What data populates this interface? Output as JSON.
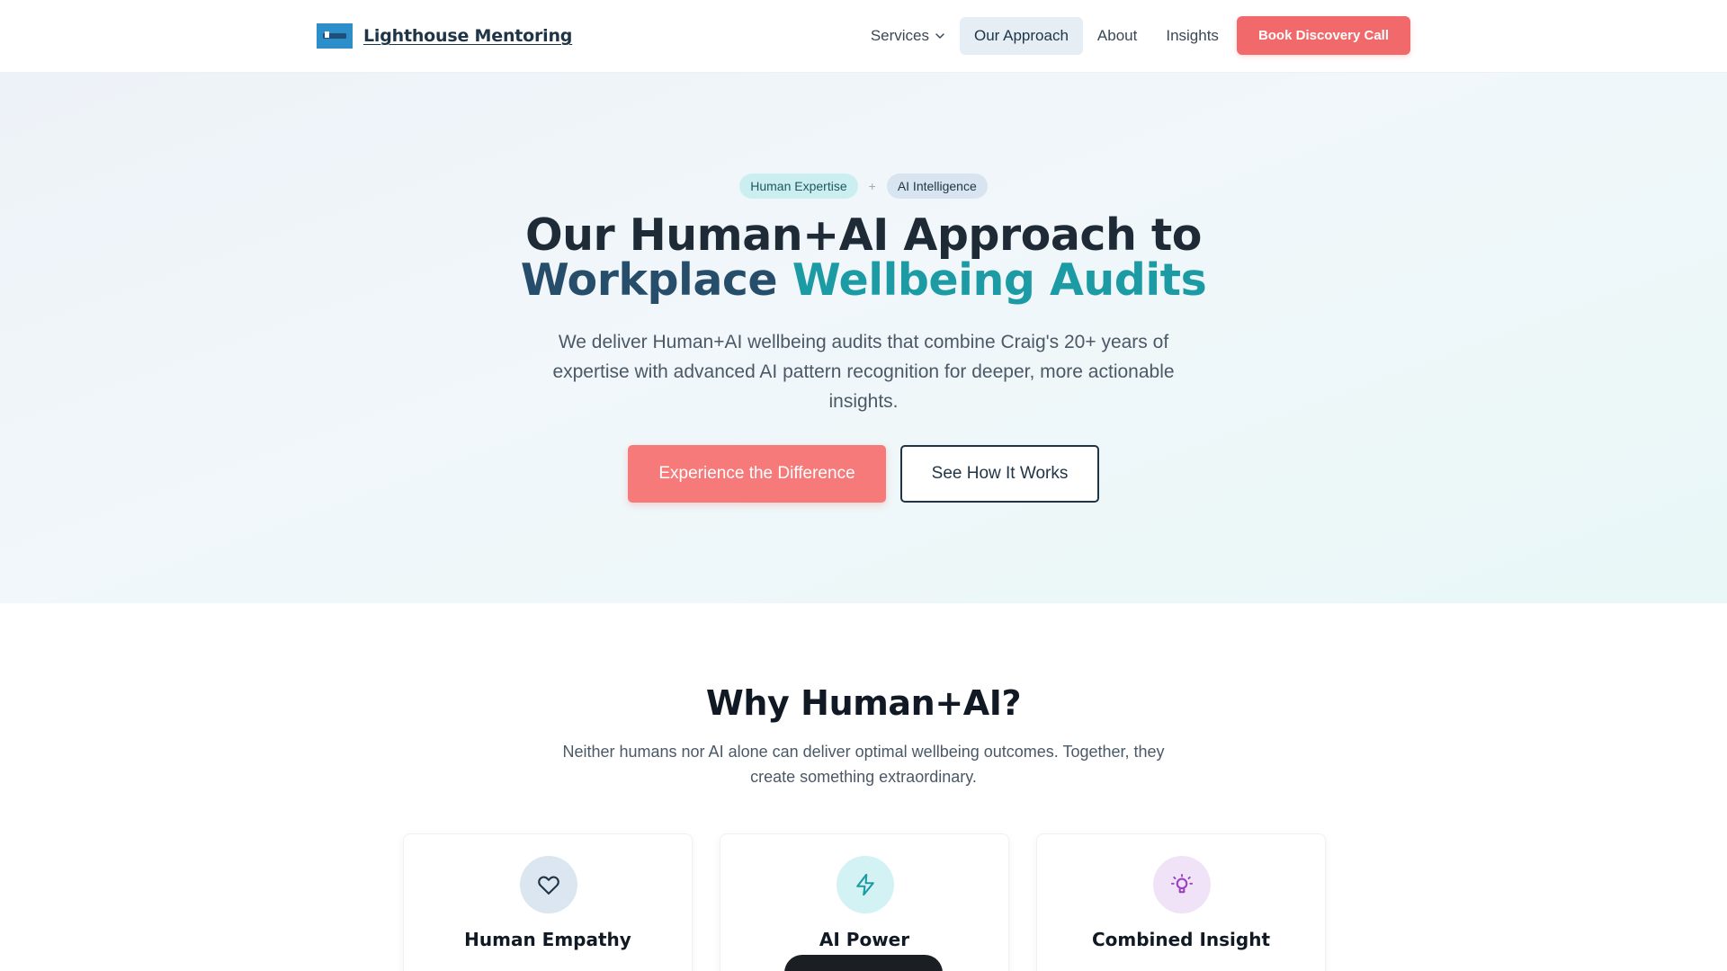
{
  "header": {
    "brand_name": "Lighthouse Mentoring",
    "nav": {
      "services": "Services",
      "approach": "Our Approach",
      "about": "About",
      "insights": "Insights"
    },
    "cta": "Book Discovery Call"
  },
  "hero": {
    "pill_human": "Human Expertise",
    "pill_plus": "+",
    "pill_ai": "AI Intelligence",
    "title_line1": "Our Human+AI Approach to",
    "title_word_workplace": "Workplace",
    "title_word_wellbeing_audits": "Wellbeing Audits",
    "subtitle": "We deliver Human+AI wellbeing audits that combine Craig's 20+ years of expertise with advanced AI pattern recognition for deeper, more actionable insights.",
    "primary_button": "Experience the Difference",
    "secondary_button": "See How It Works"
  },
  "why": {
    "title": "Why Human+AI?",
    "subtitle": "Neither humans nor AI alone can deliver optimal wellbeing outcomes. Together, they create something extraordinary.",
    "cards": [
      {
        "title": "Human Empathy",
        "icon": "heart-icon",
        "color": "#1f3446"
      },
      {
        "title": "AI Power",
        "icon": "lightning-icon",
        "color": "#1c9ba4"
      },
      {
        "title": "Combined Insight",
        "icon": "lightbulb-icon",
        "color": "#9b3fc4"
      }
    ]
  },
  "colors": {
    "accent": "#f2696b",
    "navy": "#1f3446",
    "teal": "#1c9ba4"
  }
}
